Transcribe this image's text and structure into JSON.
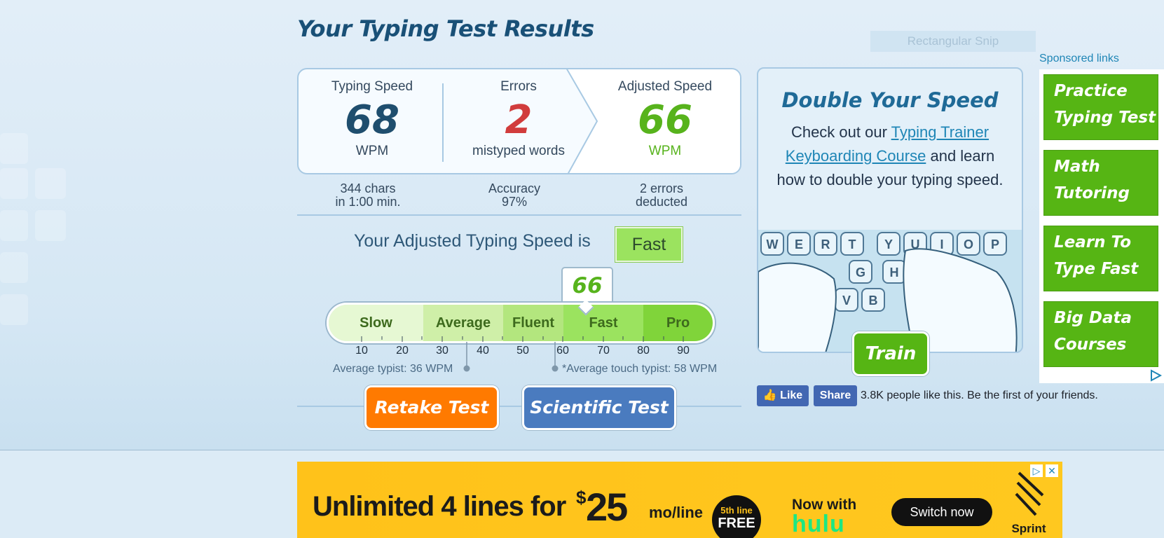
{
  "page": {
    "title": "Your Typing Test Results"
  },
  "overlay": {
    "snip_label": "Rectangular Snip"
  },
  "results": {
    "typing_speed": {
      "label": "Typing Speed",
      "value": "68",
      "unit": "WPM"
    },
    "errors": {
      "label": "Errors",
      "value": "2",
      "unit": "mistyped words"
    },
    "adjusted_speed": {
      "label": "Adjusted Speed",
      "value": "66",
      "unit": "WPM"
    },
    "sub": [
      {
        "line1": "344 chars",
        "line2": "in 1:00 min."
      },
      {
        "line1": "Accuracy",
        "line2": "97%"
      },
      {
        "line1": "2 errors",
        "line2": "deducted"
      }
    ],
    "colors": {
      "speed": "#1f4e6e",
      "errors": "#d13c3c",
      "adjusted": "#57b31c"
    }
  },
  "level": {
    "prefix": "Your Adjusted Typing Speed is",
    "badge": "Fast"
  },
  "speed_scale": {
    "marker": "66",
    "marker_value": 66,
    "segments": [
      {
        "label": "Slow",
        "color": "#e6f8d3"
      },
      {
        "label": "Average",
        "color": "#cfefa8"
      },
      {
        "label": "Fluent",
        "color": "#b3e67e"
      },
      {
        "label": "Fast",
        "color": "#9be35f"
      },
      {
        "label": "Pro",
        "color": "#80d43a"
      }
    ],
    "ticks": [
      "10",
      "20",
      "30",
      "40",
      "50",
      "60",
      "70",
      "80",
      "90"
    ],
    "average_typist": "Average typist: 36 WPM",
    "average_touch_typist": "*Average touch typist: 58 WPM"
  },
  "buttons": {
    "retake": "Retake Test",
    "scientific": "Scientific Test",
    "retake_color": "#ff7a00",
    "scientific_color": "#4a7bbf"
  },
  "promo": {
    "heading": "Double Your Speed",
    "text_before": "Check out our",
    "link1": "Typing Trainer",
    "link2": "Keyboarding Course",
    "text_after": "and learn how to double your typing speed.",
    "train_button": "Train",
    "keys_row1": [
      "W",
      "E",
      "R",
      "T",
      "Y",
      "U",
      "I",
      "O",
      "P"
    ],
    "keys_row2": [
      "G",
      "H"
    ],
    "keys_row3": [
      "V",
      "B"
    ]
  },
  "social": {
    "like": "Like",
    "share": "Share",
    "text": "3.8K people like this. Be the first of your friends."
  },
  "sponsored": {
    "label": "Sponsored links",
    "items": [
      {
        "line1": "Practice",
        "line2": "Typing Test"
      },
      {
        "line1": "Math",
        "line2": "Tutoring"
      },
      {
        "line1": "Learn To",
        "line2": "Type Fast"
      },
      {
        "line1": "Big Data",
        "line2": "Courses"
      }
    ]
  },
  "banner": {
    "headline": "Unlimited 4 lines for",
    "dollar": "$",
    "price": "25",
    "per": "mo/line",
    "badge_line1": "5th line",
    "badge_line2": "FREE",
    "now_with": "Now with",
    "hulu": "hulu",
    "cta": "Switch now",
    "brand": "Sprint"
  }
}
